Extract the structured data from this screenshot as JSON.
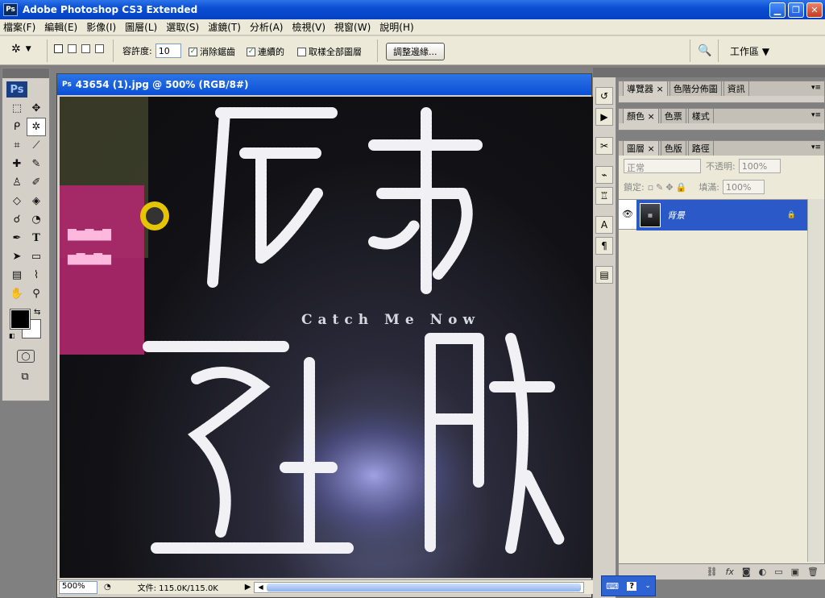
{
  "window": {
    "title": "Adobe Photoshop CS3 Extended",
    "app_icon": "Ps"
  },
  "menu": [
    "檔案(F)",
    "編輯(E)",
    "影像(I)",
    "圖層(L)",
    "選取(S)",
    "濾鏡(T)",
    "分析(A)",
    "檢視(V)",
    "視窗(W)",
    "說明(H)"
  ],
  "options": {
    "tolerance_label": "容許度:",
    "tolerance_value": "10",
    "antialias_label": "消除鋸齒",
    "contiguous_label": "連續的",
    "sample_all_label": "取樣全部圖層",
    "refine_edge_label": "調整邊緣...",
    "workspace_label": "工作區 ▼"
  },
  "toolbox": {
    "logo": "Ps"
  },
  "document": {
    "title": "43654 (1).jpg @ 500% (RGB/8#)",
    "zoom": "500%",
    "file_info": "文件: 115.0K/115.0K",
    "art_subtitle": "Catch Me Now"
  },
  "panels": {
    "group1": [
      "導覽器",
      "色階分佈圖",
      "資訊"
    ],
    "group2": [
      "顏色",
      "色票",
      "樣式"
    ],
    "group3": [
      "圖層",
      "色版",
      "路徑"
    ]
  },
  "layers": {
    "blend_mode": "正常",
    "opacity_label": "不透明:",
    "opacity_value": "100%",
    "lock_label": "鎖定:",
    "fill_label": "填滿:",
    "fill_value": "100%",
    "layer_name": "背景"
  }
}
